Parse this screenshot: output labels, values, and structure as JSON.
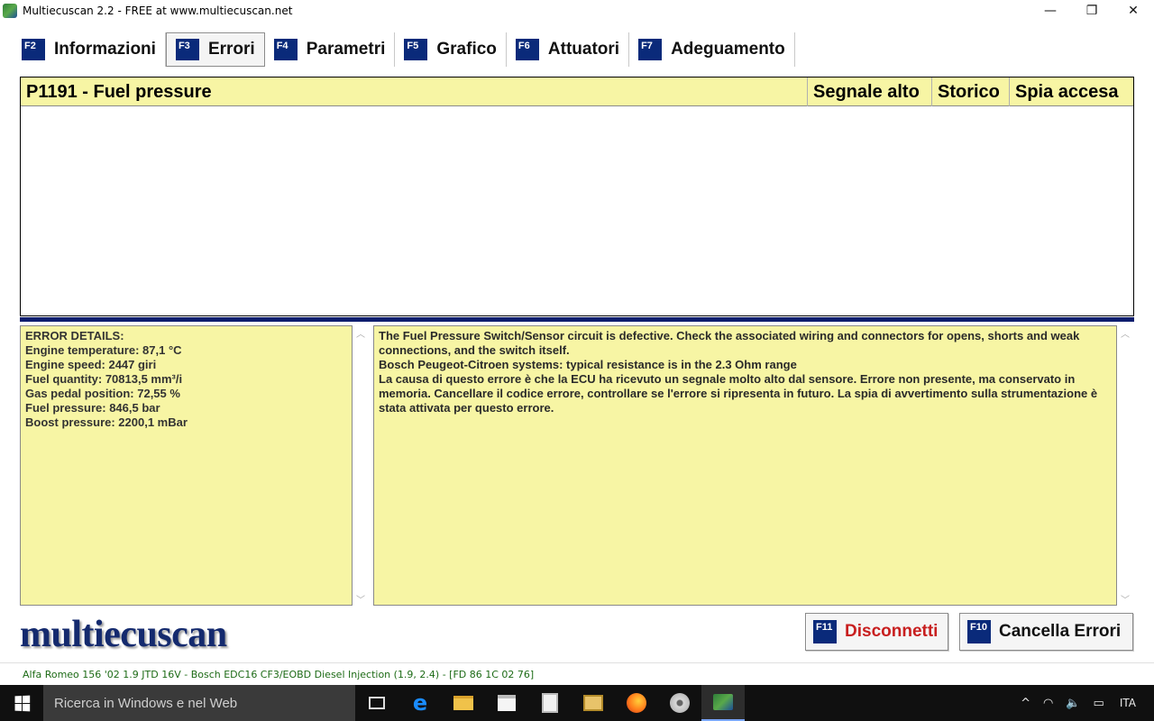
{
  "window": {
    "title": "Multiecuscan 2.2 - FREE at www.multiecuscan.net",
    "minimize_glyph": "—",
    "maximize_glyph": "❐",
    "close_glyph": "✕"
  },
  "tabs": [
    {
      "key": "F2",
      "label": "Informazioni",
      "active": false
    },
    {
      "key": "F3",
      "label": "Errori",
      "active": true
    },
    {
      "key": "F4",
      "label": "Parametri",
      "active": false
    },
    {
      "key": "F5",
      "label": "Grafico",
      "active": false
    },
    {
      "key": "F6",
      "label": "Attuatori",
      "active": false
    },
    {
      "key": "F7",
      "label": "Adeguamento",
      "active": false
    }
  ],
  "error_table": {
    "code_title": "P1191 - Fuel pressure",
    "columns": [
      "Segnale alto",
      "Storico",
      "Spia accesa"
    ]
  },
  "details": {
    "lines": [
      "ERROR DETAILS:",
      "Engine temperature: 87,1 °C",
      "Engine speed: 2447 giri",
      "Fuel quantity: 70813,5 mm³/i",
      "Gas pedal position: 72,55 %",
      "Fuel pressure: 846,5 bar",
      "Boost pressure: 2200,1 mBar"
    ]
  },
  "description": {
    "lines": [
      "The Fuel Pressure Switch/Sensor circuit is defective. Check the associated wiring and connectors for opens, shorts and weak connections, and the switch itself.",
      "Bosch Peugeot-Citroen systems: typical resistance is in the 2.3 Ohm range",
      "La causa di questo errore è che la ECU ha ricevuto un segnale molto alto dal sensore. Errore non presente, ma conservato in memoria. Cancellare il codice errore, controllare se l'errore si ripresenta in futuro. La spia di avvertimento sulla strumentazione è stata attivata per questo errore."
    ]
  },
  "logo": "multiecuscan",
  "buttons": {
    "disconnect": {
      "key": "F11",
      "label": "Disconnetti"
    },
    "clear": {
      "key": "F10",
      "label": "Cancella Errori"
    }
  },
  "status_bar": "Alfa Romeo 156 '02 1.9 JTD 16V - Bosch EDC16 CF3/EOBD Diesel Injection (1.9, 2.4) - [FD 86 1C 02 76]",
  "taskbar": {
    "search_placeholder": "Ricerca in Windows e nel Web",
    "language": "ITA",
    "icons": [
      "task-view-icon",
      "edge-icon",
      "file-explorer-icon",
      "store-icon",
      "calculator-icon",
      "media-player-icon",
      "firefox-icon",
      "disc-icon",
      "multiecuscan-icon"
    ]
  },
  "colors": {
    "panel_bg": "#f7f5a4",
    "fkey_bg": "#0a2a7a",
    "divider": "#0e1e6e",
    "disconnect_text": "#c81f1f",
    "status_text": "#1d6b16"
  }
}
